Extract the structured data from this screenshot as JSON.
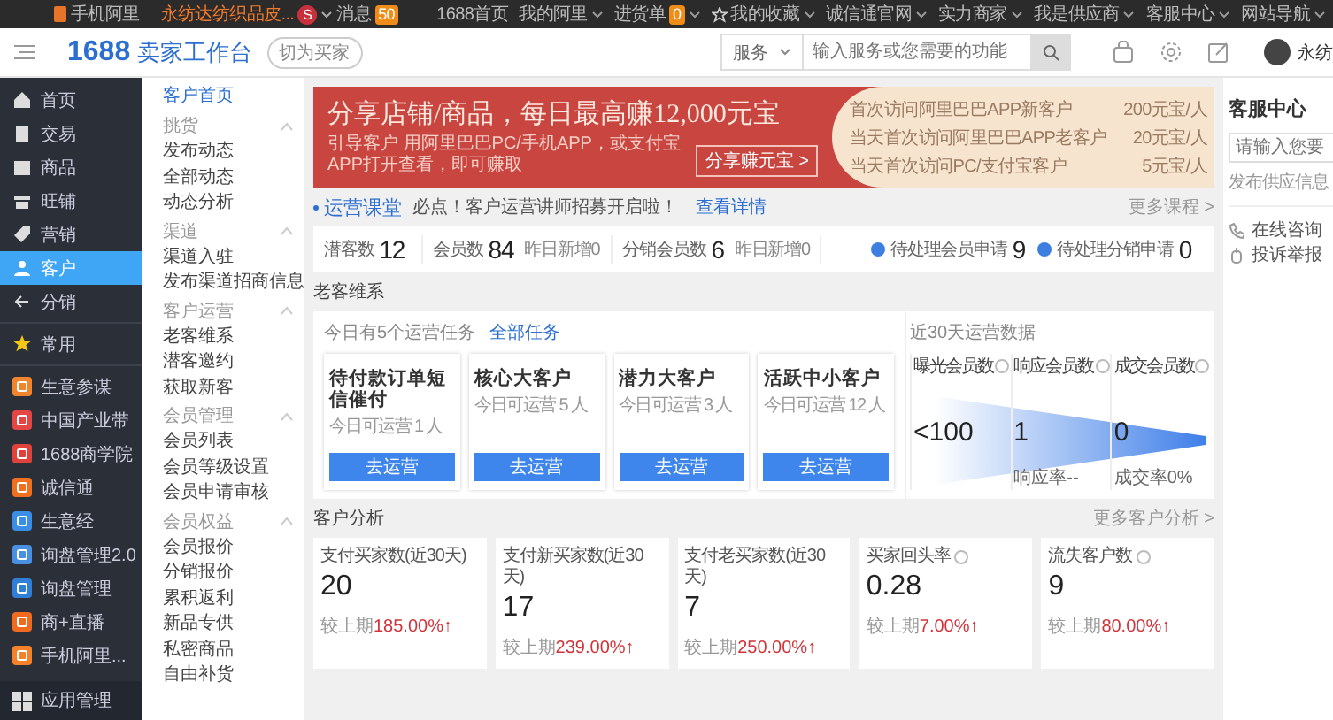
{
  "top_bar": {
    "mobile": "手机阿里",
    "shop": "永纺达纺织品皮...",
    "shop_badge": "S",
    "messages": "消息",
    "message_count": "50",
    "links": [
      {
        "label": "1688首页",
        "kind": "plain",
        "dropdown": false
      },
      {
        "label": "我的阿里",
        "kind": "plain",
        "dropdown": true
      },
      {
        "label": "进货单",
        "kind": "count",
        "count": "0",
        "dropdown": true
      },
      {
        "label": "我的收藏",
        "kind": "starred",
        "dropdown": true
      },
      {
        "label": "诚信通官网",
        "kind": "plain",
        "dropdown": true
      },
      {
        "label": "实力商家",
        "kind": "plain",
        "dropdown": true
      },
      {
        "label": "我是供应商",
        "kind": "plain",
        "dropdown": true
      },
      {
        "label": "客服中心",
        "kind": "plain",
        "dropdown": true
      },
      {
        "label": "网站导航",
        "kind": "plain",
        "dropdown": true
      }
    ]
  },
  "header": {
    "logo": "1688",
    "title": "卖家工作台",
    "switch_button": "切为买家",
    "search": {
      "scope": "服务",
      "placeholder": "输入服务或您需要的功能"
    },
    "user_name": "永纺"
  },
  "sidebar": {
    "nav": [
      {
        "label": "首页",
        "selected": false
      },
      {
        "label": "交易",
        "selected": false
      },
      {
        "label": "商品",
        "selected": false
      },
      {
        "label": "旺铺",
        "selected": false
      },
      {
        "label": "营销",
        "selected": false
      },
      {
        "label": "客户",
        "selected": true
      },
      {
        "label": "分销",
        "selected": false
      }
    ],
    "favorites": "常用",
    "apps": [
      {
        "label": "生意参谋",
        "color": "#f0852d"
      },
      {
        "label": "中国产业带",
        "color": "#e64545"
      },
      {
        "label": "1688商学院",
        "color": "#e0413a"
      },
      {
        "label": "诚信通",
        "color": "#f07020"
      },
      {
        "label": "生意经",
        "color": "#3a8ee6"
      },
      {
        "label": "询盘管理2.0",
        "color": "#4a90e2"
      },
      {
        "label": "询盘管理",
        "color": "#2f7fd6"
      },
      {
        "label": "商+直播",
        "color": "#f06a1f"
      },
      {
        "label": "手机阿里...",
        "color": "#f5822a"
      }
    ],
    "app_manage": "应用管理"
  },
  "submenu": {
    "home": {
      "label": "客户首页",
      "selected": true
    },
    "groups": [
      {
        "title": "挑货",
        "expanded": true,
        "items": [
          {
            "label": "发布动态",
            "selected": false
          },
          {
            "label": "全部动态",
            "selected": false
          },
          {
            "label": "动态分析",
            "selected": false
          }
        ]
      },
      {
        "title": "渠道",
        "expanded": true,
        "items": [
          {
            "label": "渠道入驻",
            "selected": false
          },
          {
            "label": "发布渠道招商信息",
            "selected": false
          }
        ]
      },
      {
        "title": "客户运营",
        "expanded": true,
        "items": [
          {
            "label": "老客维系",
            "selected": false
          },
          {
            "label": "潜客邀约",
            "selected": false
          },
          {
            "label": "获取新客",
            "selected": false
          }
        ]
      },
      {
        "title": "会员管理",
        "expanded": true,
        "items": [
          {
            "label": "会员列表",
            "selected": false
          },
          {
            "label": "会员等级设置",
            "selected": false
          },
          {
            "label": "会员申请审核",
            "selected": false
          }
        ]
      },
      {
        "title": "会员权益",
        "expanded": true,
        "items": [
          {
            "label": "会员报价",
            "selected": false
          },
          {
            "label": "分销报价",
            "selected": false
          },
          {
            "label": "累积返利",
            "selected": false
          },
          {
            "label": "新品专供",
            "selected": false
          },
          {
            "label": "私密商品",
            "selected": false
          },
          {
            "label": "自由补货",
            "selected": false
          }
        ]
      }
    ]
  },
  "banner": {
    "title": "分享店铺/商品，每日最高赚12,000元宝",
    "subtitle": "引导客户 用阿里巴巴PC/手机APP，或支付宝APP打开查看，即可赚取",
    "button": "分享赚元宝 >",
    "rewards": [
      {
        "label": "首次访问阿里巴巴APP新客户",
        "value": "200元宝/人"
      },
      {
        "label": "当天首次访问阿里巴巴APP老客户",
        "value": "20元宝/人"
      },
      {
        "label": "当天首次访问PC/支付宝客户",
        "value": "5元宝/人"
      }
    ]
  },
  "course": {
    "title": "运营课堂",
    "notice": "必点！客户运营讲师招募开启啦！",
    "link": "查看详情",
    "more": "更多课程 >"
  },
  "stats": {
    "items": [
      {
        "label": "潜客数",
        "value": "12"
      },
      {
        "label": "会员数",
        "value": "84",
        "note": "昨日新增0"
      },
      {
        "label": "分销会员数",
        "value": "6",
        "note": "昨日新增0"
      }
    ],
    "pending": [
      {
        "label": "待处理会员申请",
        "value": "9"
      },
      {
        "label": "待处理分销申请",
        "value": "0"
      }
    ]
  },
  "retention": {
    "heading": "老客维系",
    "tasks_note": "今日有5个运营任务",
    "all_tasks": "全部任务",
    "tasks": [
      {
        "title": "待付款订单短信催付",
        "note": "今日可运营 1 人",
        "button": "去运营"
      },
      {
        "title": "核心大客户",
        "note": "今日可运营 5 人",
        "button": "去运营"
      },
      {
        "title": "潜力大客户",
        "note": "今日可运营 3 人",
        "button": "去运营"
      },
      {
        "title": "活跃中小客户",
        "note": "今日可运营 12 人",
        "button": "去运营"
      }
    ],
    "data_title": "近30天运营数据",
    "metrics": [
      {
        "label": "曝光会员数",
        "value": "<100"
      },
      {
        "label": "响应会员数",
        "value": "1",
        "rate": "响应率--"
      },
      {
        "label": "成交会员数",
        "value": "0",
        "rate": "成交率0%"
      }
    ]
  },
  "analysis": {
    "heading": "客户分析",
    "more": "更多客户分析 >",
    "cards": [
      {
        "label": "支付买家数(近30天)",
        "value": "20",
        "compare": "较上期",
        "change": "185.00%↑",
        "help": false
      },
      {
        "label": "支付新买家数(近30天)",
        "value": "17",
        "compare": "较上期",
        "change": "239.00%↑",
        "help": false
      },
      {
        "label": "支付老买家数(近30天)",
        "value": "7",
        "compare": "较上期",
        "change": "250.00%↑",
        "help": false
      },
      {
        "label": "买家回头率",
        "value": "0.28",
        "compare": "较上期",
        "change": "7.00%↑",
        "help": true
      },
      {
        "label": "流失客户数",
        "value": "9",
        "compare": "较上期",
        "change": "80.00%↑",
        "help": true
      }
    ]
  },
  "service": {
    "title": "客服中心",
    "placeholder": "请输入您要",
    "hint": "发布供应信息",
    "links": [
      {
        "label": "在线咨询"
      },
      {
        "label": "投诉举报"
      }
    ]
  }
}
